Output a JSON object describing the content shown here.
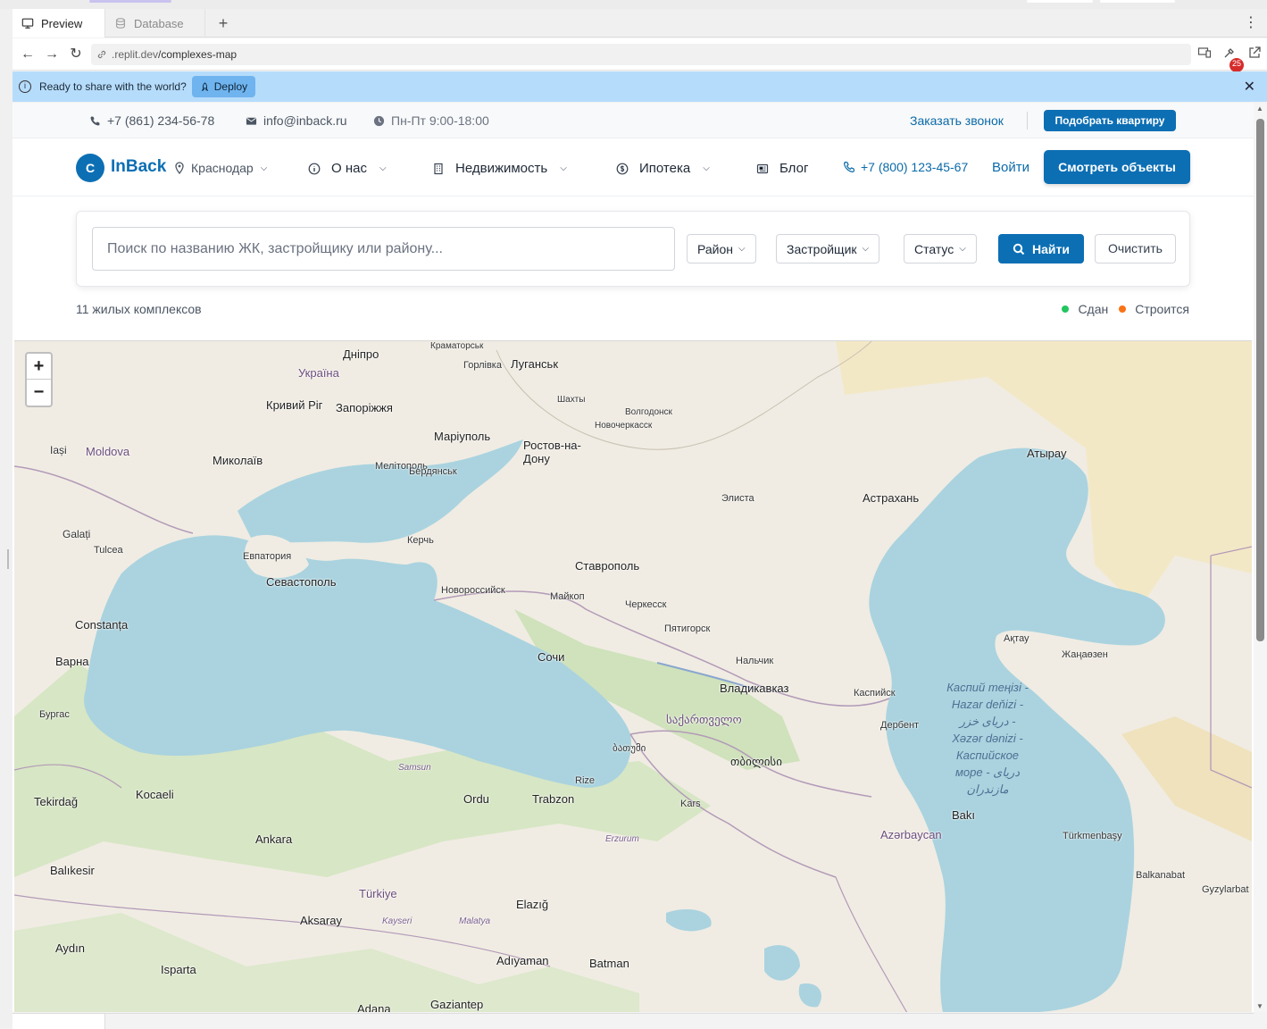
{
  "browser": {
    "tabs": [
      {
        "label": "Preview",
        "icon": "monitor-icon"
      },
      {
        "label": "Database",
        "icon": "database-icon"
      }
    ],
    "url_host": ".replit.dev",
    "url_path": "/complexes-map",
    "notification_count": "25"
  },
  "banner": {
    "text": "Ready to share with the world?",
    "deploy_label": "Deploy"
  },
  "topinfo": {
    "phone": "+7 (861) 234-56-78",
    "email": "info@inback.ru",
    "hours": "Пн-Пт 9:00-18:00",
    "callback": "Заказать звонок",
    "pick": "Подобрать квартиру"
  },
  "nav": {
    "logo_letter": "C",
    "logo_text": "InBack",
    "city": "Краснодар",
    "about": "О нас",
    "realty": "Недвижимость",
    "mortgage": "Ипотека",
    "blog": "Блог",
    "phone": "+7 (800) 123-45-67",
    "login": "Войти",
    "cta": "Смотреть объекты"
  },
  "search": {
    "placeholder": "Поиск по названию ЖК, застройщику или району...",
    "district": "Район",
    "developer": "Застройщик",
    "status": "Статус",
    "find": "Найти",
    "clear": "Очистить"
  },
  "results": {
    "count": "11 жилых комплексов",
    "legend_done": "Сдан",
    "legend_building": "Строится",
    "color_done": "#22c55e",
    "color_building": "#f97316"
  },
  "map": {
    "zoom_in": "+",
    "zoom_out": "−",
    "labels": {
      "ukraine": "Україна",
      "dnipro": "Дніпро",
      "kramatorsk": "Краматорськ",
      "horlivka": "Горлівка",
      "luhansk": "Луганськ",
      "kryvyi_rih": "Кривий Ріг",
      "zaporizhzhia": "Запоріжжя",
      "mariupol": "Маріуполь",
      "mykolaiv": "Миколаїв",
      "melitopol": "Мелітополь",
      "berdiansk": "Бердянськ",
      "moldova": "Moldova",
      "iasi": "Iași",
      "galati": "Galați",
      "tulcea": "Tulcea",
      "constanta": "Constanța",
      "varna": "Варна",
      "burgas": "Бургас",
      "rostov": "Ростов-на-Дону",
      "shakhty": "Шахты",
      "novocherkassk": "Новочеркасск",
      "volgodonsk": "Волгодонск",
      "elista": "Элиста",
      "astrakhan": "Астрахань",
      "atyrau": "Атырау",
      "kerch": "Керчь",
      "yevpatoria": "Евпатория",
      "sevastopol": "Севастополь",
      "novorossiysk": "Новороссийск",
      "maykop": "Майкоп",
      "stavropol": "Ставрополь",
      "cherkessk": "Черкесск",
      "pyatigorsk": "Пятигорск",
      "nalchik": "Нальчик",
      "vladikavkaz": "Владикавказ",
      "sochi": "Сочи",
      "kaspiysk": "Каспийск",
      "derbent": "Дербент",
      "aktau": "Ақтау",
      "zhanaozen": "Жаңаөзен",
      "georgia": "საქართველო",
      "tbilisi": "თბილისი",
      "batumi": "ბათუმი",
      "baku": "Bakı",
      "azerbaijan": "Azərbaycan",
      "turkmenbashi": "Türkmenbaşy",
      "balkanabat": "Balkanabat",
      "gyzylarbat": "Gyzylarbat",
      "samsun": "Samsun",
      "ordu": "Ordu",
      "trabzon": "Trabzon",
      "rize": "Rize",
      "ankara": "Ankara",
      "turkiye": "Türkiye",
      "kocaeli": "Kocaeli",
      "tekirdag": "Tekirdağ",
      "kayseri": "Kayseri",
      "malatya": "Malatya",
      "elazig": "Elazığ",
      "erzurum": "Erzurum",
      "kars": "Kars",
      "adiyaman": "Adıyaman",
      "batman": "Batman",
      "gaziantep": "Gaziantep",
      "adana": "Adana",
      "aksaray": "Aksaray",
      "isparta": "Isparta",
      "aydin": "Aydın",
      "balikesir": "Balıkesir",
      "caspian": "Каспий теңізі - Hazar deňizi - دریای خزر - Xəzər dənizi - Каспийское море - دریای مازندران"
    }
  }
}
